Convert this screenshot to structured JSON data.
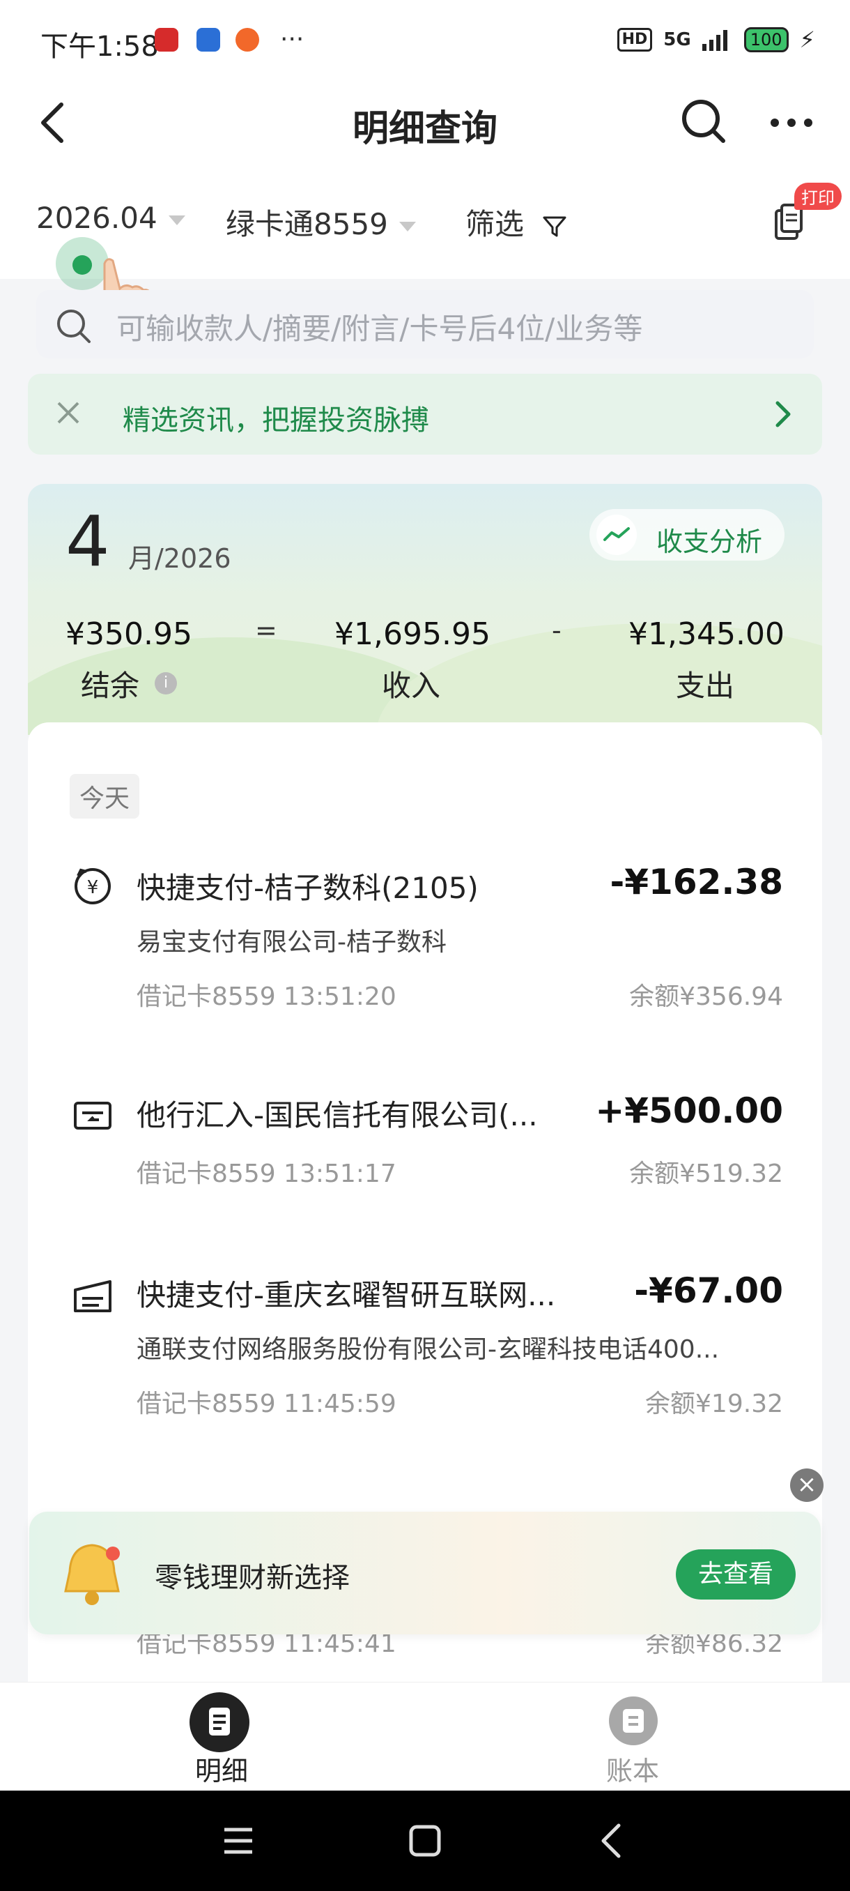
{
  "status_bar": {
    "time": "下午1:58",
    "signal": "5G",
    "battery": "100",
    "hd": "HD"
  },
  "header": {
    "title": "明细查询"
  },
  "filters": {
    "month": "2026.04",
    "account": "绿卡通8559",
    "filter_label": "筛选",
    "print_badge": "打印"
  },
  "search": {
    "placeholder": "可输收款人/摘要/附言/卡号后4位/业务等"
  },
  "promo": {
    "text": "精选资讯，把握投资脉搏"
  },
  "summary": {
    "month_number": "4",
    "month_suffix": "月/2026",
    "analysis_label": "收支分析",
    "balance": "¥350.95",
    "balance_label": "结余",
    "income": "¥1,695.95",
    "income_label": "收入",
    "expense": "¥1,345.00",
    "expense_label": "支出",
    "eq": "=",
    "minus": "-"
  },
  "list": {
    "section_label": "今天",
    "transactions": [
      {
        "title": "快捷支付-桔子数科(2105)",
        "subtitle": "易宝支付有限公司-桔子数科",
        "detail": "借记卡8559 13:51:20",
        "amount": "-¥162.38",
        "balance": "余额¥356.94"
      },
      {
        "title": "他行汇入-国民信托有限公司(...",
        "subtitle": "",
        "detail": "借记卡8559 13:51:17",
        "amount": "+¥500.00",
        "balance": "余额¥519.32"
      },
      {
        "title": "快捷支付-重庆玄曜智研互联网...",
        "subtitle": "通联支付网络服务股份有限公司-玄曜科技电话400...",
        "detail": "借记卡8559 11:45:59",
        "amount": "-¥67.00",
        "balance": "余额¥19.32"
      },
      {
        "detail": "借记卡8559 11:45:41",
        "balance": "余额¥86.32"
      }
    ]
  },
  "banner": {
    "text": "零钱理财新选择",
    "button": "去查看"
  },
  "tabs": [
    {
      "label": "明细",
      "active": true
    },
    {
      "label": "账本",
      "active": false
    }
  ],
  "colors": {
    "accent": "#25a35a",
    "promo_text": "#1f8a4a",
    "badge": "#f04a4a"
  }
}
